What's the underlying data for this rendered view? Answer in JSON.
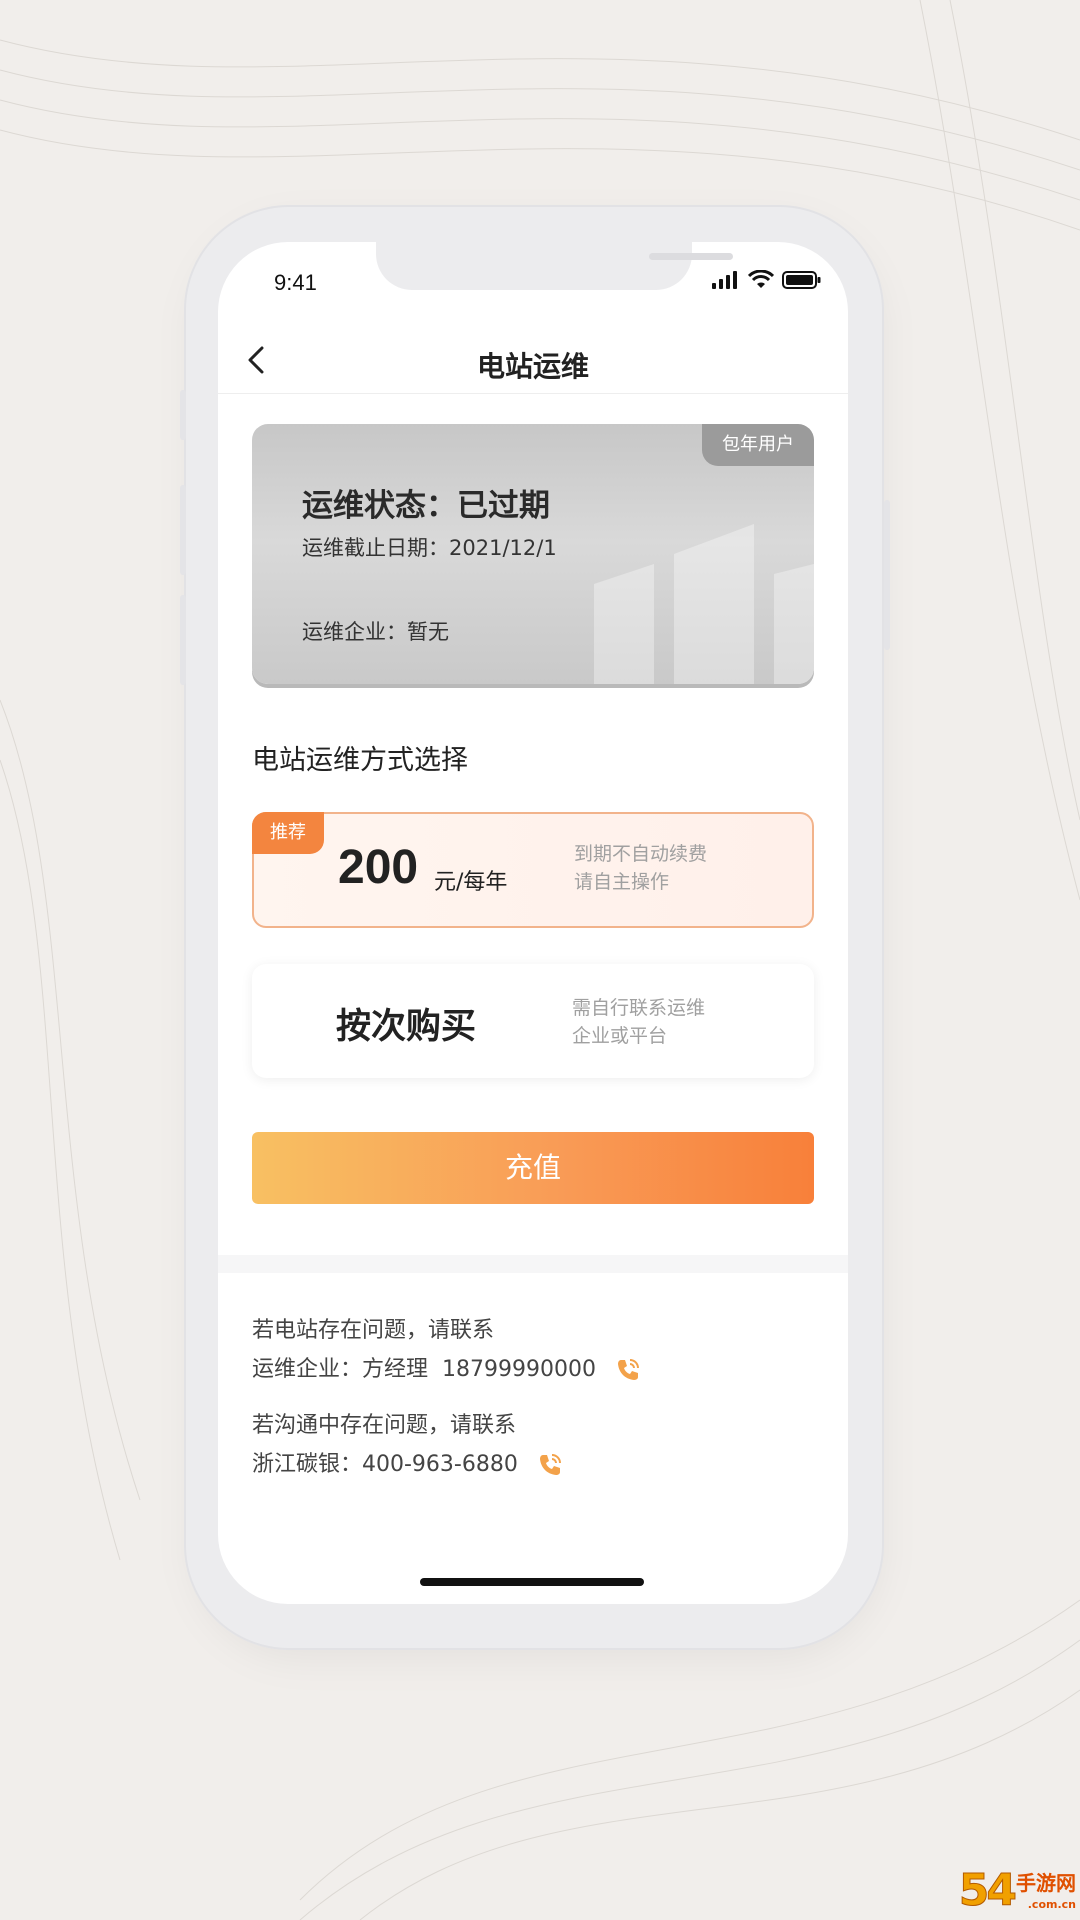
{
  "status_bar": {
    "time": "9:41"
  },
  "nav": {
    "title": "电站运维"
  },
  "status_card": {
    "badge": "包年用户",
    "title": "运维状态：已过期",
    "deadline": "运维截止日期：2021/12/1",
    "company": "运维企业：暂无"
  },
  "section_title": "电站运维方式选择",
  "plans": {
    "annual": {
      "badge": "推荐",
      "price": "200",
      "unit": "元/每年",
      "note_line1": "到期不自动续费",
      "note_line2": "请自主操作"
    },
    "per_use": {
      "title": "按次购买",
      "note_line1": "需自行联系运维",
      "note_line2": "企业或平台"
    }
  },
  "recharge_label": "充值",
  "contact": {
    "line1": "若电站存在问题，请联系",
    "line2": "运维企业：方经理  18799990000",
    "line3": "若沟通中存在问题，请联系",
    "line4": "浙江碳银：400-963-6880"
  },
  "watermark": {
    "num": "54",
    "text": "手游网",
    "sub": ".com.cn"
  },
  "colors": {
    "accent": "#f8803a",
    "accent_light": "#f8c062",
    "badge": "#f3853f"
  }
}
